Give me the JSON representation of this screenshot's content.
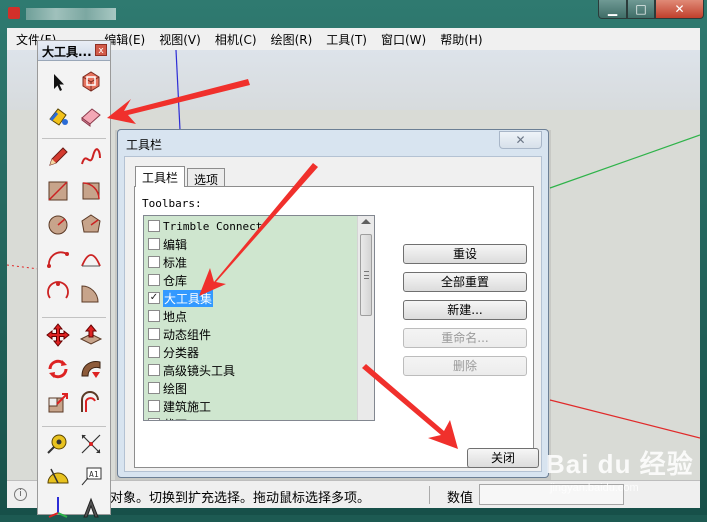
{
  "window": {
    "controls": {
      "minimize": "▁",
      "maximize": "□",
      "close": "✕"
    }
  },
  "menu": [
    "文件(F)",
    "编辑(E)",
    "视图(V)",
    "相机(C)",
    "绘图(R)",
    "工具(T)",
    "窗口(W)",
    "帮助(H)"
  ],
  "toolset": {
    "title": "大工具...",
    "close": "x",
    "tools": [
      "select-arrow-icon",
      "make-component-icon",
      "paint-bucket-icon",
      "eraser-icon",
      "pencil-icon",
      "freehand-icon",
      "rectangle-icon",
      "rotated-rectangle-icon",
      "circle-icon",
      "polygon-icon",
      "arc-icon",
      "two-point-arc-icon",
      "three-point-arc-icon",
      "pie-icon",
      "move-icon",
      "push-pull-icon",
      "rotate-icon",
      "follow-me-icon",
      "scale-icon",
      "offset-icon",
      "tape-measure-icon",
      "dimension-icon",
      "protractor-icon",
      "text-icon",
      "axes-icon",
      "3d-text-icon"
    ]
  },
  "dialog": {
    "title": "工具栏",
    "close": "✕",
    "tabs": [
      "工具栏",
      "选项"
    ],
    "list_label": "Toolbars:",
    "items": [
      {
        "label": "Trimble Connect",
        "checked": false
      },
      {
        "label": "编辑",
        "checked": false
      },
      {
        "label": "标准",
        "checked": false
      },
      {
        "label": "仓库",
        "checked": false
      },
      {
        "label": "大工具集",
        "checked": true,
        "selected": true
      },
      {
        "label": "地点",
        "checked": false
      },
      {
        "label": "动态组件",
        "checked": false
      },
      {
        "label": "分类器",
        "checked": false
      },
      {
        "label": "高级镜头工具",
        "checked": false
      },
      {
        "label": "绘图",
        "checked": false
      },
      {
        "label": "建筑施工",
        "checked": false
      },
      {
        "label": "截面",
        "checked": false
      }
    ],
    "check_mark": "✓",
    "buttons": {
      "reset": "重设",
      "reset_all": "全部重置",
      "new": "新建...",
      "rename": "重命名...",
      "delete": "删除",
      "close": "关闭"
    }
  },
  "status": {
    "info": "i",
    "text": "对象。切换到扩充选择。拖动鼠标选择多项。",
    "measure_label": "数值",
    "measure_value": ""
  },
  "watermark": {
    "brand": "Bai du 经验",
    "url": "jingyan.baidu.com"
  },
  "colors": {
    "arrow": "#f0302c",
    "selection": "#3399ff",
    "list_bg": "#cfe6cf"
  }
}
